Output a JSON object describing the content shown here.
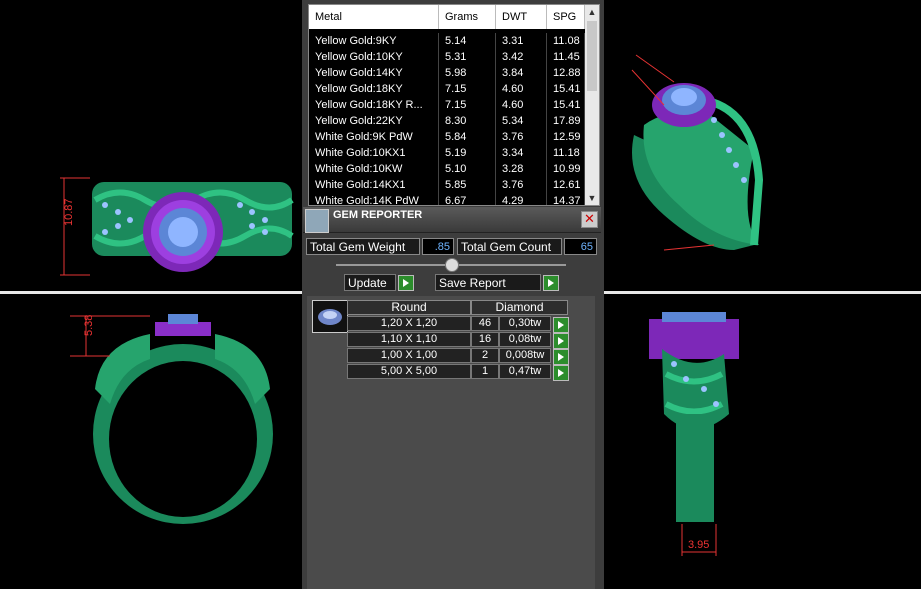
{
  "metal_table": {
    "headers": [
      "Metal",
      "Grams",
      "DWT",
      "SPG"
    ],
    "rows": [
      [
        "Yellow Gold:9KY",
        "5.14",
        "3.31",
        "11.08"
      ],
      [
        "Yellow Gold:10KY",
        "5.31",
        "3.42",
        "11.45"
      ],
      [
        "Yellow Gold:14KY",
        "5.98",
        "3.84",
        "12.88"
      ],
      [
        "Yellow Gold:18KY",
        "7.15",
        "4.60",
        "15.41"
      ],
      [
        "Yellow Gold:18KY R...",
        "7.15",
        "4.60",
        "15.41"
      ],
      [
        "Yellow Gold:22KY",
        "8.30",
        "5.34",
        "17.89"
      ],
      [
        "White Gold:9K PdW",
        "5.84",
        "3.76",
        "12.59"
      ],
      [
        "White Gold:10KX1",
        "5.19",
        "3.34",
        "11.18"
      ],
      [
        "White Gold:10KW",
        "5.10",
        "3.28",
        "10.99"
      ],
      [
        "White Gold:14KX1",
        "5.85",
        "3.76",
        "12.61"
      ],
      [
        "White Gold:14K PdW",
        "6.67",
        "4.29",
        "14.37"
      ]
    ]
  },
  "gem_reporter": {
    "title": "GEM REPORTER",
    "total_weight_label": "Total Gem Weight",
    "total_weight_value": ".85",
    "total_count_label": "Total Gem Count",
    "total_count_value": "65",
    "update_label": "Update",
    "save_label": "Save Report",
    "gem_header": [
      "Round",
      "Diamond"
    ],
    "gems": [
      {
        "size": "1,20 X 1,20",
        "count": "46",
        "weight": "0,30tw"
      },
      {
        "size": "1,10 X 1,10",
        "count": "16",
        "weight": "0,08tw"
      },
      {
        "size": "1,00 X 1,00",
        "count": "2",
        "weight": "0,008tw"
      },
      {
        "size": "5,00 X 5,00",
        "count": "1",
        "weight": "0,47tw"
      }
    ]
  },
  "dimensions": {
    "top_view_height": "10.87",
    "front_view_height": "5.38",
    "side_view_width": "3.95"
  },
  "colors": {
    "ring_metal": "#1fa06a",
    "setting": "#8a2fc9",
    "stones": "#8fb5ff",
    "dimension": "#e53333"
  }
}
